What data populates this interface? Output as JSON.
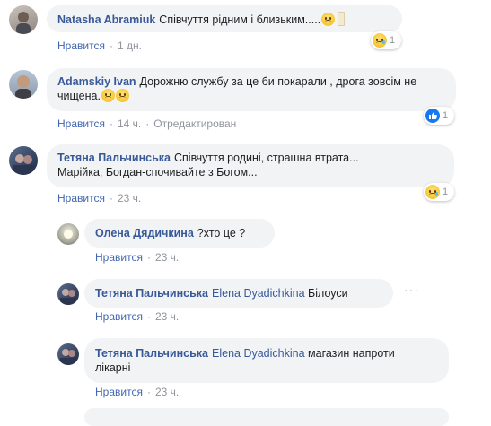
{
  "comments": [
    {
      "author": "Natasha Abramiuk",
      "text": "Співчуття рідним і близьким.....",
      "action_label": "Нравится",
      "time": "1 дн.",
      "reaction_count": "1"
    },
    {
      "author": "Adamskiy Ivan",
      "text": "Дорожню службу за це би покарали , дрога зовсім не чищена.",
      "action_label": "Нравится",
      "time": "14 ч.",
      "edited": "Отредактирован",
      "reaction_count": "1"
    },
    {
      "author": "Тетяна Пальчинська",
      "text_line1": "Співчуття родині, страшна втрата...",
      "text_line2": "Марійка, Богдан-спочивайте з Богом...",
      "action_label": "Нравится",
      "time": "23 ч.",
      "reaction_count": "1"
    }
  ],
  "replies": [
    {
      "author": "Олена Дядичкина",
      "text": "?хто це ?",
      "action_label": "Нравится",
      "time": "23 ч."
    },
    {
      "author": "Тетяна Пальчинська",
      "mention": "Elena Dyadichkina",
      "text": "Білоуси",
      "action_label": "Нравится",
      "time": "23 ч.",
      "more": "···"
    },
    {
      "author": "Тетяна Пальчинська",
      "mention": "Elena Dyadichkina",
      "text_line1": "магазин напроти",
      "text_line2": "лікарні",
      "action_label": "Нравится",
      "time": "23 ч."
    }
  ],
  "separator": "·",
  "colors": {
    "link": "#385898",
    "action": "#4267b2",
    "muted": "#90949c",
    "bubble": "#f2f3f5"
  }
}
